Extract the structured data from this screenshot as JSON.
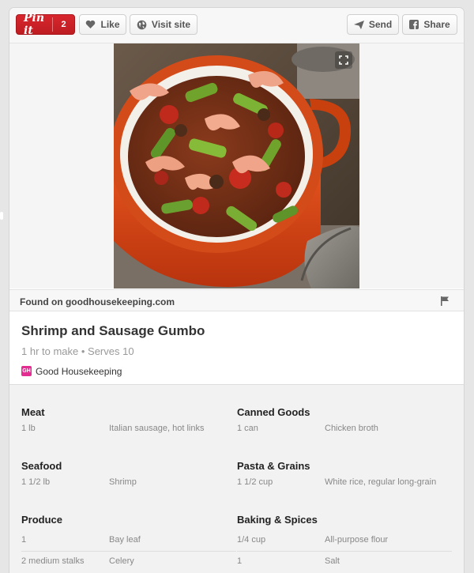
{
  "toolbar": {
    "pinit_label": "Pin it",
    "pin_count": "2",
    "like_label": "Like",
    "visit_label": "Visit site",
    "send_label": "Send",
    "share_label": "Share",
    "icons": {
      "like": "heart-icon",
      "visit": "globe-icon",
      "send": "paper-plane-icon",
      "share": "facebook-icon"
    }
  },
  "pin": {
    "image_alt": "Shrimp and Sausage Gumbo in an orange pot",
    "found_on_text": "Found on goodhousekeeping.com",
    "title": "Shrimp and Sausage Gumbo",
    "meta": "1 hr to make • Serves 10",
    "source_logo_text": "GH",
    "source_name": "Good Housekeeping"
  },
  "ingredients": {
    "left": [
      {
        "heading": "Meat",
        "items": [
          {
            "qty": "1 lb",
            "name": "Italian sausage, hot links"
          }
        ]
      },
      {
        "heading": "Seafood",
        "items": [
          {
            "qty": "1 1/2 lb",
            "name": "Shrimp"
          }
        ]
      },
      {
        "heading": "Produce",
        "items": [
          {
            "qty": "1",
            "name": "Bay leaf"
          },
          {
            "qty": "2 medium stalks",
            "name": "Celery"
          }
        ]
      }
    ],
    "right": [
      {
        "heading": "Canned Goods",
        "items": [
          {
            "qty": "1 can",
            "name": "Chicken broth"
          }
        ]
      },
      {
        "heading": "Pasta & Grains",
        "items": [
          {
            "qty": "1 1/2 cup",
            "name": "White rice, regular long-grain"
          }
        ]
      },
      {
        "heading": "Baking & Spices",
        "items": [
          {
            "qty": "1/4 cup",
            "name": "All-purpose flour"
          },
          {
            "qty": "1",
            "name": "Salt"
          }
        ]
      }
    ]
  },
  "colors": {
    "pinit_red": "#cb2027",
    "pot_orange": "#d9481c",
    "gh_pink": "#e32d91"
  }
}
